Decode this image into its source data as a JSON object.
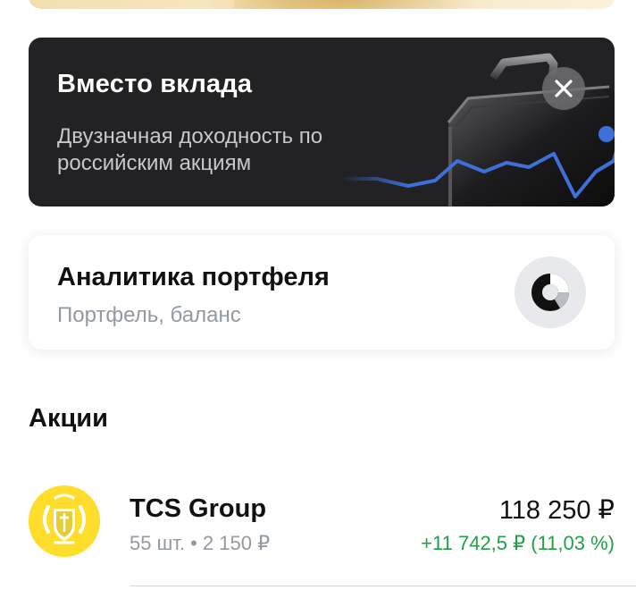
{
  "promo": {
    "title": "Вместо вклада",
    "subtitle": "Двузначная доходность по российским акциям",
    "close_icon": "close-icon",
    "chart_color": "#3f6fd8"
  },
  "analytics": {
    "title": "Аналитика портфеля",
    "subtitle": "Портфель, баланс",
    "icon": "donut-chart-icon"
  },
  "stocks_section": {
    "title": "Акции"
  },
  "stocks": [
    {
      "name": "TCS Group",
      "quantity_price": "55 шт. • 2 150 ₽",
      "value": "118 250 ₽",
      "change": "+11 742,5 ₽ (11,03 %)",
      "logo": "tcs-group-logo",
      "change_color": "#22a046"
    }
  ],
  "colors": {
    "promo_bg": "#222224",
    "logo_yellow": "#ffdd2d",
    "positive": "#22a046"
  }
}
